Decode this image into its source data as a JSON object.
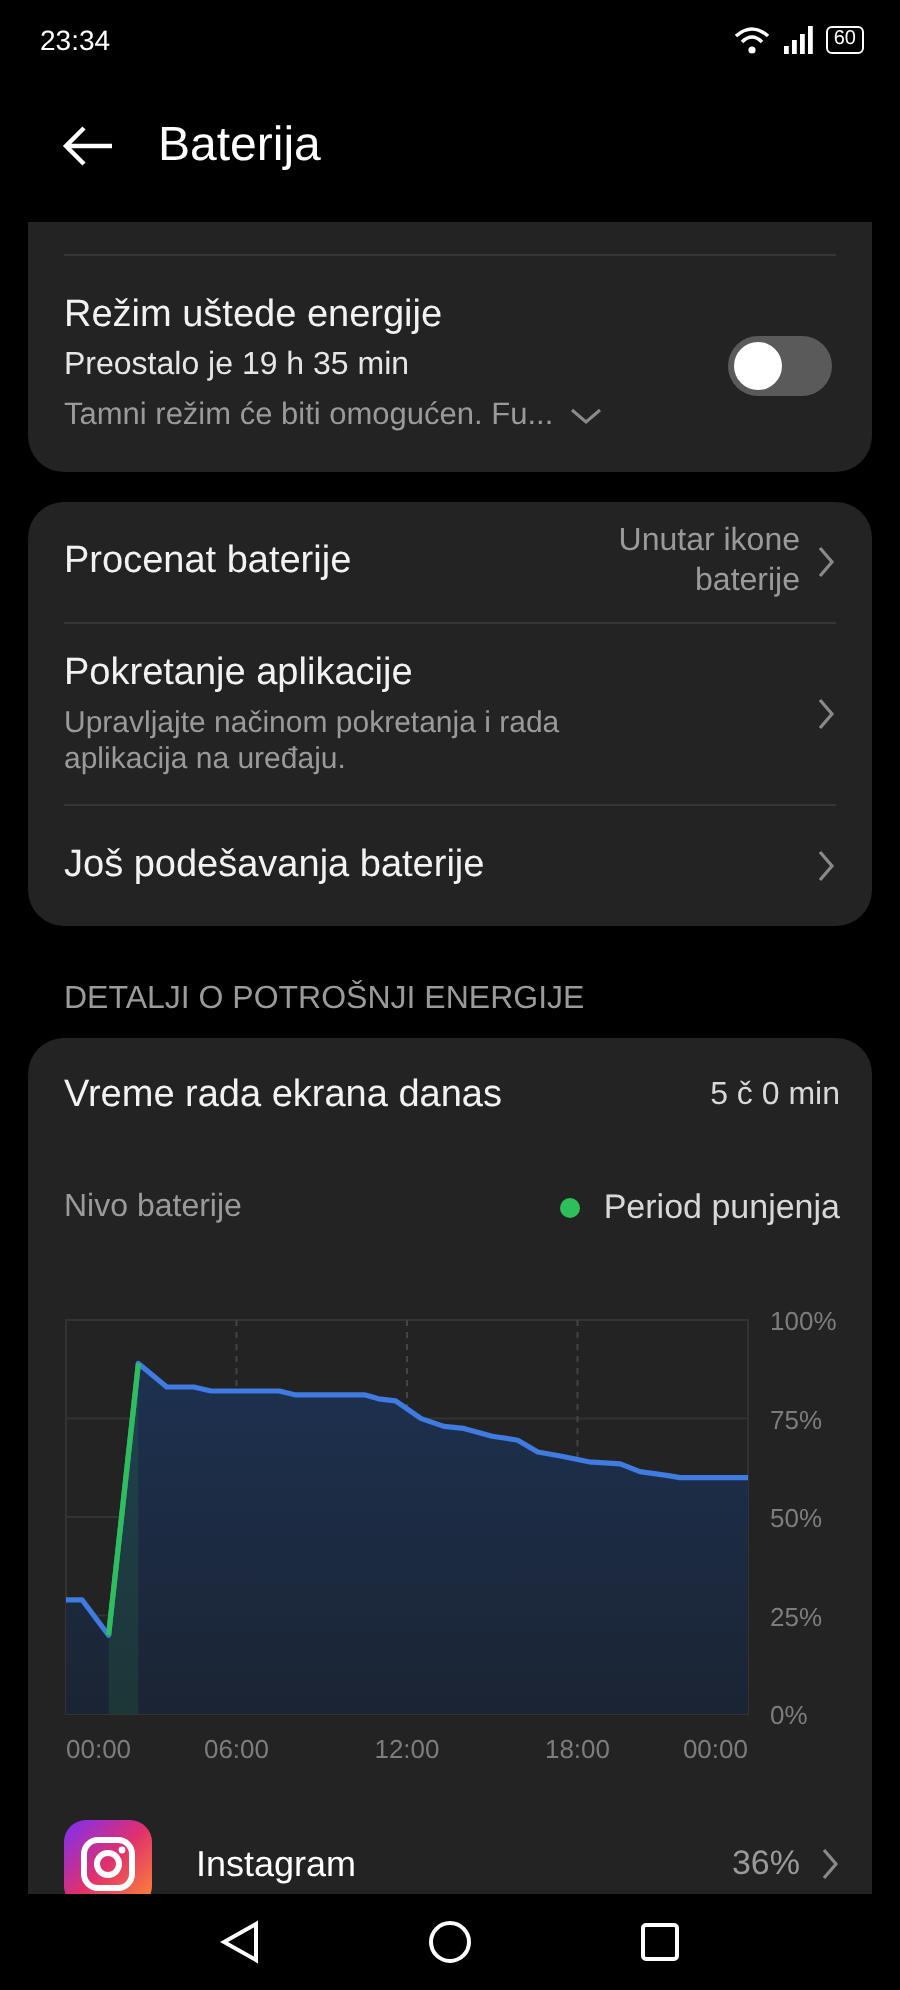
{
  "status_bar": {
    "time": "23:34",
    "battery": "60"
  },
  "header": {
    "title": "Baterija"
  },
  "power_saving": {
    "title": "Režim uštede energije",
    "subtitle": "Preostalo je 19 h 35 min",
    "note": "Tamni režim će biti omogućen. Fu...",
    "on": false
  },
  "settings": [
    {
      "title": "Procenat baterije",
      "value": [
        "Unutar ikone",
        "baterije"
      ]
    },
    {
      "title": "Pokretanje aplikacije",
      "subtitle": "Upravljajte načinom pokretanja i rada aplikacija na uređaju."
    },
    {
      "title": "Još podešavanja baterije"
    }
  ],
  "section_label": "DETALJI O POTROŠNJI ENERGIJE",
  "usage": {
    "screen_time_label": "Vreme rada ekrana danas",
    "screen_time": "5 č 0 min",
    "chart_data": {
      "type": "area",
      "title": "Nivo baterije",
      "x": [
        0,
        0.56,
        1.5,
        2.55,
        3.55,
        4.5,
        5.1,
        7.5,
        8.05,
        10.5,
        11,
        11.6,
        12.5,
        13.3,
        14,
        15,
        15.9,
        16.6,
        17.4,
        18.4,
        19.5,
        20.2,
        21.2,
        21.6,
        24
      ],
      "series": [
        {
          "color": "#3f7be0",
          "values": [
            29,
            29,
            20,
            89,
            83,
            83,
            82,
            82,
            81,
            81,
            80,
            79.5,
            75,
            73,
            72.5,
            70.5,
            69.5,
            66.5,
            65.5,
            64,
            63.5,
            61.5,
            60.5,
            60,
            60
          ]
        },
        {
          "name": "Period punjenja",
          "color": "#2fbf5a",
          "values": [
            null,
            null,
            20,
            89,
            null,
            null,
            null,
            null,
            null,
            null,
            null,
            null,
            null,
            null,
            null,
            null,
            null,
            null,
            null,
            null,
            null,
            null,
            null,
            null,
            null
          ]
        }
      ],
      "grid": true,
      "xlim": [
        0,
        24
      ],
      "ylim": [
        0,
        100
      ],
      "xticks": [
        {
          "value": 0,
          "label": "00:00"
        },
        {
          "value": 6,
          "label": "06:00"
        },
        {
          "value": 12,
          "label": "12:00"
        },
        {
          "value": 18,
          "label": "18:00"
        },
        {
          "value": 24,
          "label": "00:00"
        }
      ],
      "yticks": [
        {
          "value": 0,
          "label": "0%"
        },
        {
          "value": 25,
          "label": "25%"
        },
        {
          "value": 50,
          "label": "50%"
        },
        {
          "value": 75,
          "label": "75%"
        },
        {
          "value": 100,
          "label": "100%"
        }
      ]
    },
    "apps": [
      {
        "name": "Instagram",
        "share": "36%"
      }
    ]
  }
}
